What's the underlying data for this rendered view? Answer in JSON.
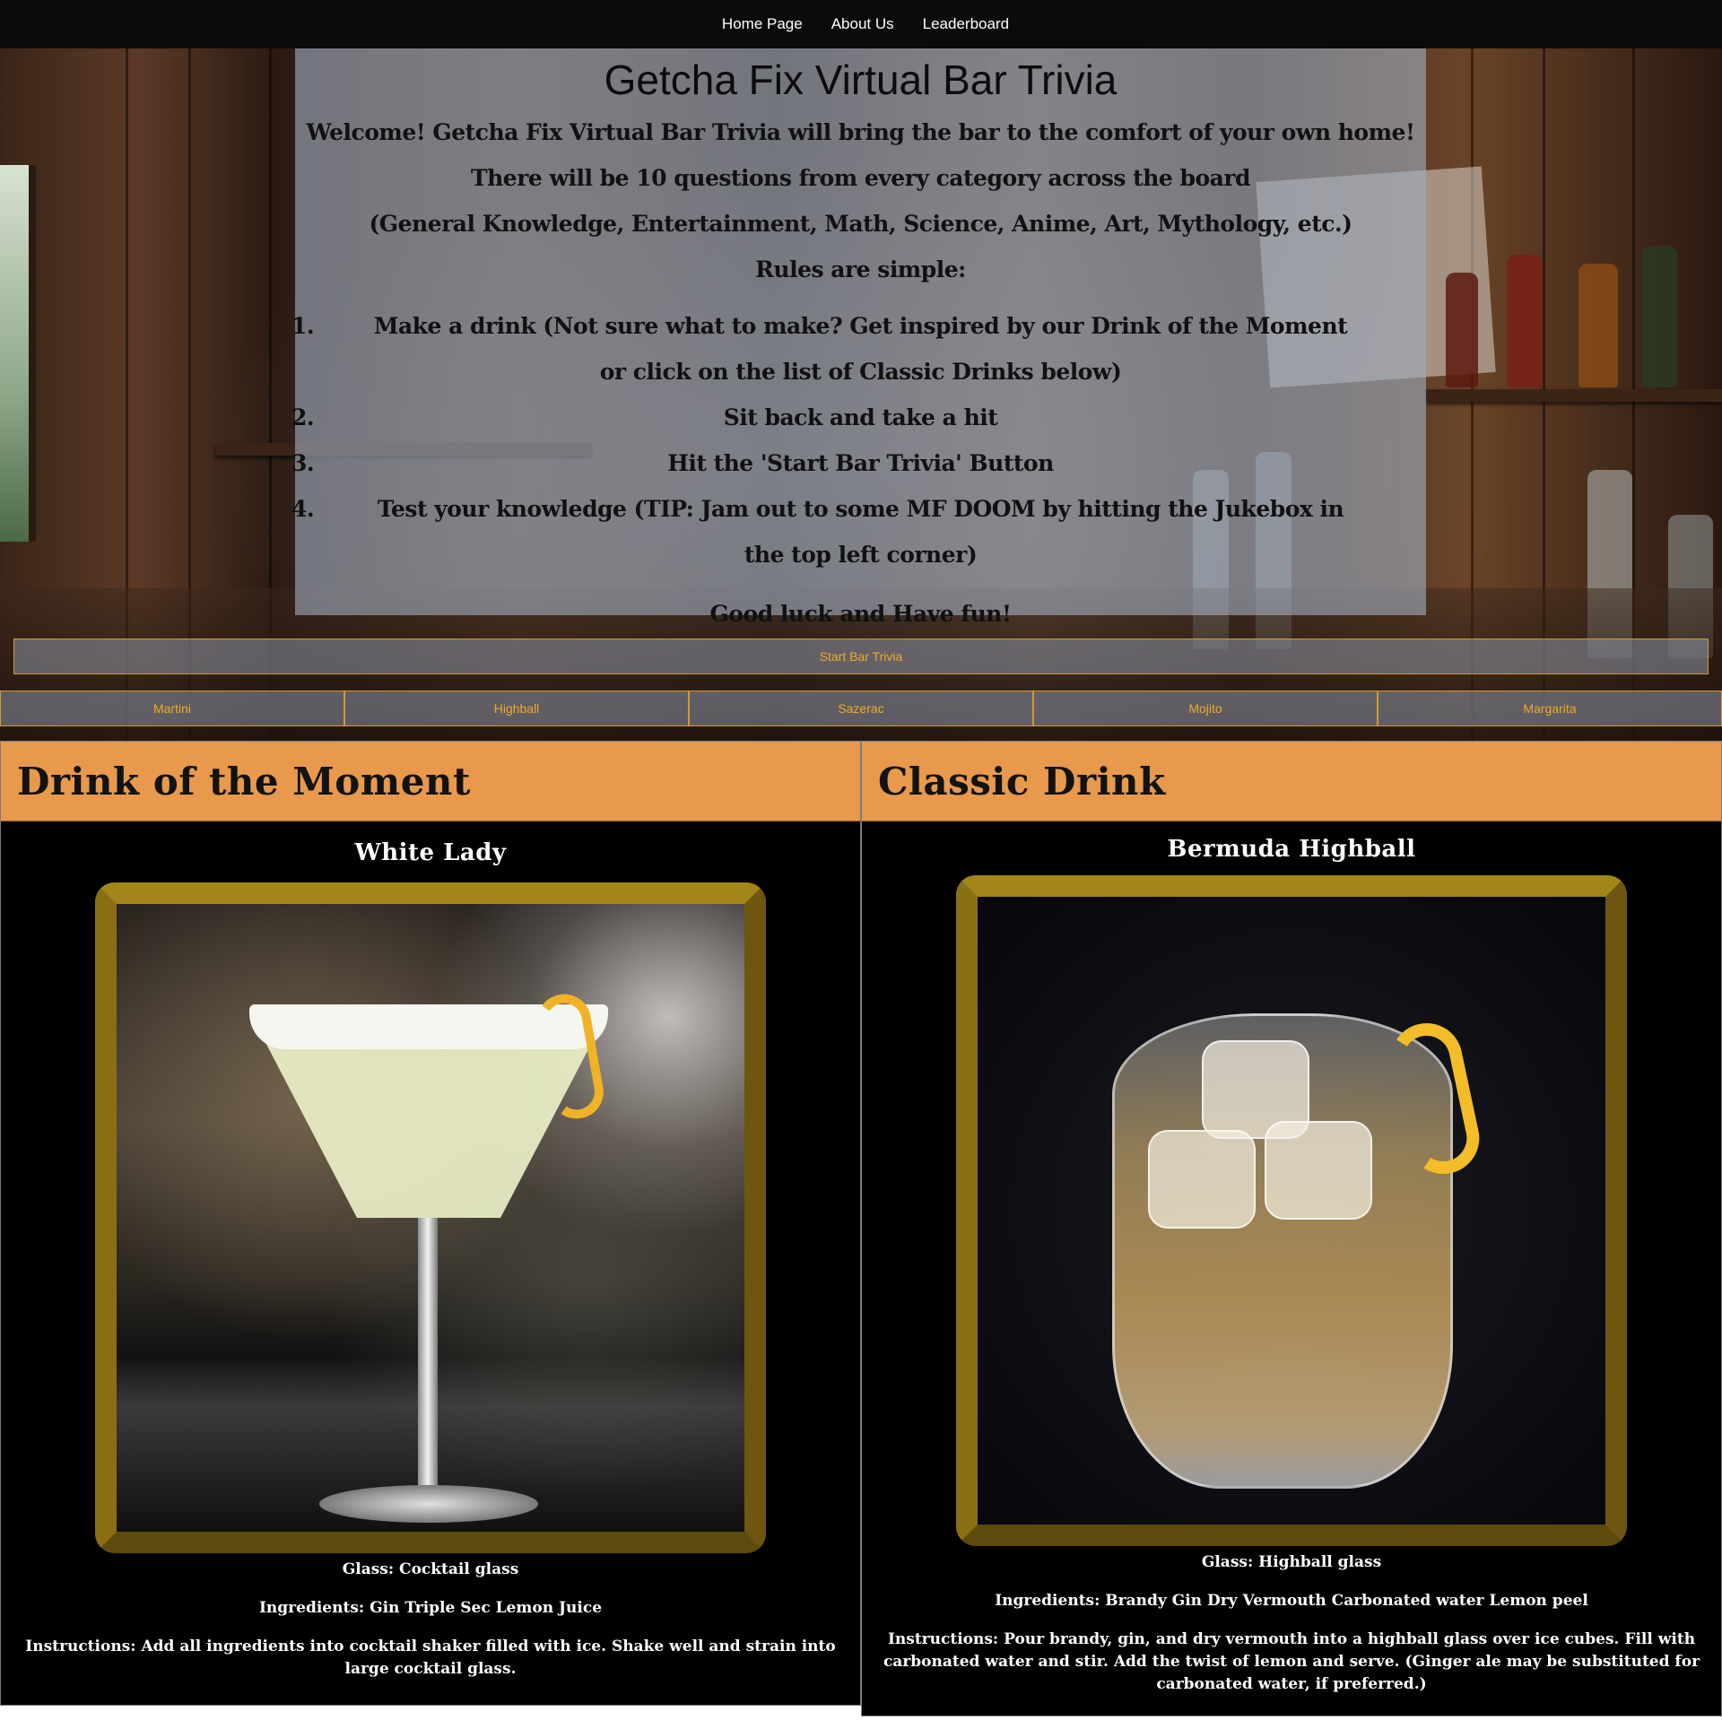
{
  "nav": {
    "items": [
      "Home Page",
      "About Us",
      "Leaderboard"
    ]
  },
  "intro": {
    "title": "Getcha Fix Virtual Bar Trivia",
    "paragraphs": [
      "Welcome! Getcha Fix Virtual Bar Trivia will bring the bar to the comfort of your own home!",
      "There will be 10 questions from every category across the board",
      "(General Knowledge, Entertainment, Math, Science, Anime, Art, Mythology, etc.)",
      "Rules are simple:"
    ],
    "rules": [
      {
        "num": "1.",
        "text": "Make a drink (Not sure what to make? Get inspired by our Drink of the Moment or click on the list of Classic Drinks below)"
      },
      {
        "num": "2.",
        "text": "Sit back and take a hit"
      },
      {
        "num": "3.",
        "text": "Hit the 'Start Bar Trivia' Button"
      },
      {
        "num": "4.",
        "text": "Test your knowledge (TIP: Jam out to some MF DOOM by hitting the Jukebox in the top left corner)"
      }
    ],
    "closing": "Good luck and Have fun!"
  },
  "start_button": "Start Bar Trivia",
  "drink_buttons": [
    "Martini",
    "Highball",
    "Sazerac",
    "Mojito",
    "Margarita"
  ],
  "drink_of_moment": {
    "heading": "Drink of the Moment",
    "name": "White Lady",
    "glass": "Glass: Cocktail glass",
    "ingredients": "Ingredients: Gin Triple Sec Lemon Juice",
    "instructions": "Instructions: Add all ingredients into cocktail shaker filled with ice. Shake well and strain into large cocktail glass."
  },
  "classic_drink": {
    "heading": "Classic Drink",
    "name": "Bermuda Highball",
    "glass": "Glass: Highball glass",
    "ingredients": "Ingredients: Brandy Gin Dry Vermouth Carbonated water Lemon peel",
    "instructions": "Instructions: Pour brandy, gin, and dry vermouth into a highball glass over ice cubes. Fill with carbonated water and stir. Add the twist of lemon and serve. (Ginger ale may be substituted for carbonated water, if preferred.)"
  },
  "colors": {
    "nav_bg": "#0b0b0b",
    "panel_header": "#e8994c",
    "button_text": "#f0a828",
    "button_border": "#d49a2a",
    "frame_gold": "#9a7d16"
  }
}
